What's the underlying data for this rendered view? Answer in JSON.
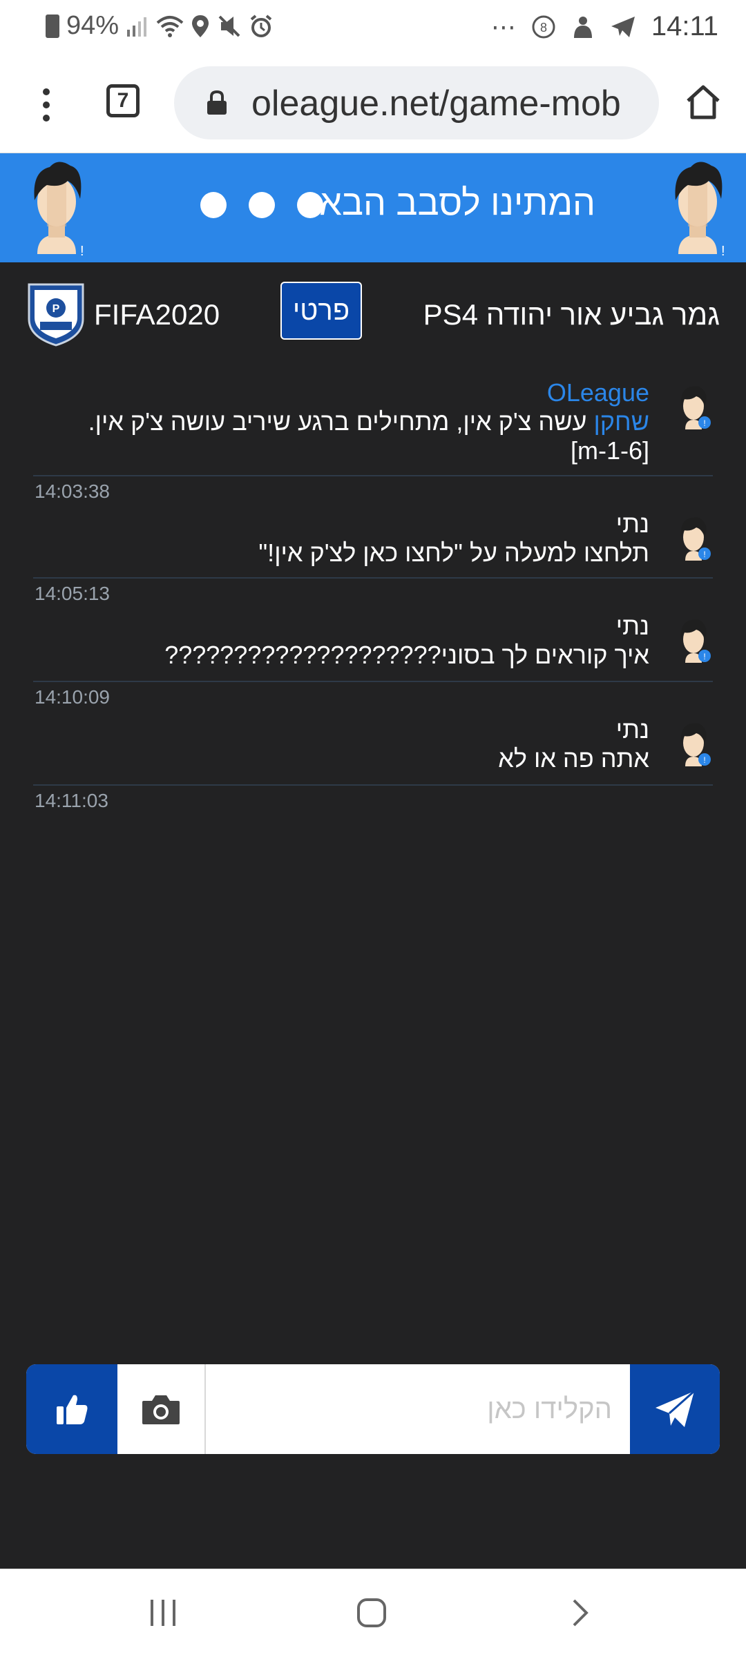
{
  "status_bar": {
    "battery": "94%",
    "time": "14:11",
    "icons_left": [
      "battery-icon",
      "signal-icon",
      "wifi-icon",
      "location-icon",
      "mute-icon",
      "alarm-icon"
    ],
    "icons_right": [
      "more-icon",
      "sync-icon",
      "app-icon",
      "telegram-icon"
    ]
  },
  "browser": {
    "tab_count": "7",
    "url": "oleague.net/game-mob"
  },
  "game_header": {
    "status_text": "המתינו לסבב הבא"
  },
  "match": {
    "game_name": "FIFA2020",
    "private_label": "פרטי",
    "title": "גמר גביע אור יהודה PS4"
  },
  "messages": [
    {
      "sender": "OLeague",
      "highlight": "שחקן",
      "text": " עשה צ'ק אין, מתחילים ברגע שיריב עושה צ'ק אין.",
      "extra": "[m-1-6]",
      "time": "14:03:38"
    },
    {
      "sender": "נתי",
      "text": "תלחצו למעלה על \"לחצו כאן לצ'ק אין!\"",
      "time": "14:05:13"
    },
    {
      "sender": "נתי",
      "text": "איך קוראים לך בסוני????????????????????",
      "time": "14:10:09"
    },
    {
      "sender": "נתי",
      "text": "אתה פה או לא",
      "time": "14:11:03"
    }
  ],
  "composer": {
    "placeholder": "הקלידו כאן"
  },
  "colors": {
    "header_blue": "#2b86e8",
    "button_blue": "#0a47a8",
    "background": "#222223"
  }
}
